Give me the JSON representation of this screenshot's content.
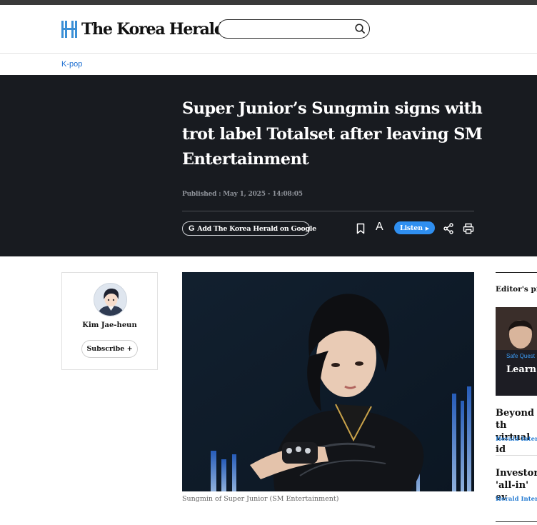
{
  "site": {
    "logo_text": "The Korea Herald",
    "search_placeholder": ""
  },
  "breadcrumb": {
    "category": "K-pop"
  },
  "article": {
    "headline": "Super Junior’s Sungmin signs with trot label Totalset after leaving SM Entertainment",
    "published": "Published : May 1, 2025 - 14:08:05",
    "photo_caption": "Sungmin of Super Junior (SM Entertainment)"
  },
  "toolbar": {
    "google_label": "Add The Korea Herald on Google",
    "google_icon": "G",
    "font_label": "A",
    "listen_label": "Listen",
    "listen_icon": "▶",
    "icons": [
      "bookmark-icon",
      "font-size-icon",
      "share-icon",
      "print-icon"
    ]
  },
  "author": {
    "name": "Kim Jae-heun",
    "subscribe_label": "Subscribe +"
  },
  "aside": {
    "title": "Editor's pi",
    "feature": {
      "tag": "Safe Quest",
      "title": "Learn drama"
    },
    "items": [
      {
        "title": "Beyond th virtual id",
        "sub": "Herald Intervi"
      },
      {
        "title": "Investors 'all-in' ev",
        "sub": "Herald Intervi"
      }
    ]
  },
  "colors": {
    "hero_bg": "#181b20",
    "accent_blue": "#2f8ff0",
    "link_blue": "#1d6fd1",
    "logo_blue": "#3a8fd6"
  }
}
